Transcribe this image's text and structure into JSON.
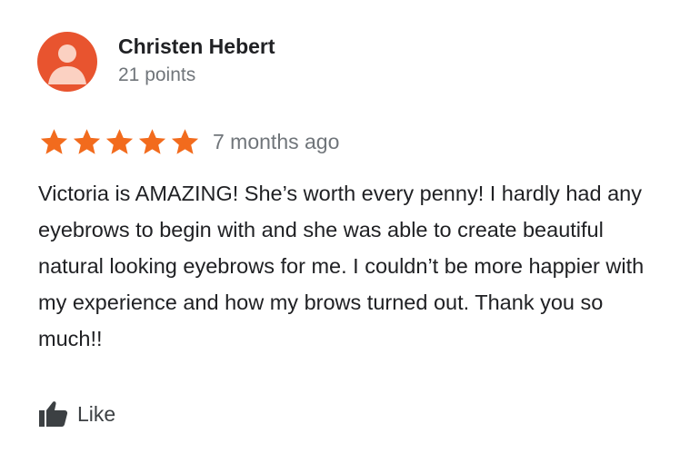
{
  "review": {
    "author": {
      "name": "Christen Hebert",
      "points": "21 points",
      "avatar_icon": "person-icon",
      "avatar_color": "#e8542f"
    },
    "rating": {
      "stars": 5,
      "max_stars": 5,
      "star_color": "#f26b1d",
      "time_ago": "7 months ago"
    },
    "text": "Victoria is AMAZING! She’s worth every penny! I hardly had any eyebrows to begin with and she was able to create beautiful natural looking eyebrows for me. I couldn’t be more happier with my experience and how my brows turned out. Thank you so much!!",
    "actions": {
      "like_label": "Like",
      "like_icon": "thumbs-up-icon"
    }
  }
}
